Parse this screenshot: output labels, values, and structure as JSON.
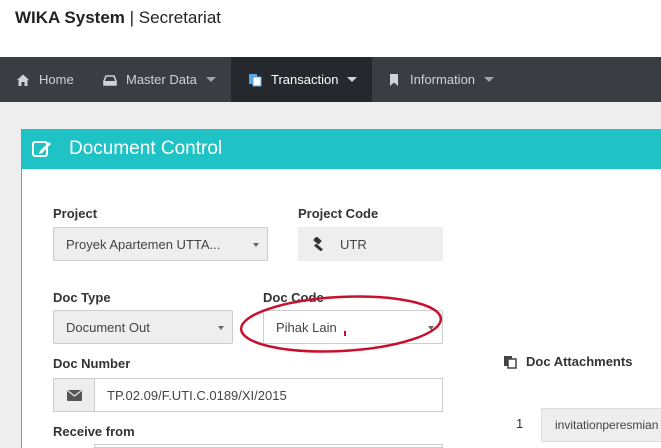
{
  "header": {
    "app_name": "WIKA System",
    "separator": "|",
    "module": "Secretariat"
  },
  "nav": {
    "items": [
      {
        "label": "Home",
        "icon": "home-icon"
      },
      {
        "label": "Master Data",
        "icon": "master-data-icon"
      },
      {
        "label": "Transaction",
        "icon": "transaction-icon",
        "active": true
      },
      {
        "label": "Information",
        "icon": "bookmark-icon"
      }
    ]
  },
  "panel": {
    "title": "Document Control",
    "title_icon": "edit-icon"
  },
  "form": {
    "project_label": "Project",
    "project_value": "Proyek Apartemen UTTA...",
    "project_code_label": "Project Code",
    "project_code_value": "UTR",
    "project_code_icon": "gavel-icon",
    "doc_type_label": "Doc Type",
    "doc_type_value": "Document Out",
    "doc_code_label": "Doc Code",
    "doc_code_value": "Pihak Lain",
    "doc_number_label": "Doc Number",
    "doc_number_value": "TP.02.09/F.UTI.C.0189/XI/2015",
    "doc_number_icon": "envelope-icon",
    "receive_from_label": "Receive from"
  },
  "attachments": {
    "title": "Doc Attachments",
    "icon": "copy-icon",
    "items": [
      {
        "num": "1",
        "name": "invitationperesmian"
      }
    ]
  },
  "colors": {
    "accent": "#1fc3c6",
    "navbar": "#3a3d42",
    "annotation": "#c8102e"
  }
}
